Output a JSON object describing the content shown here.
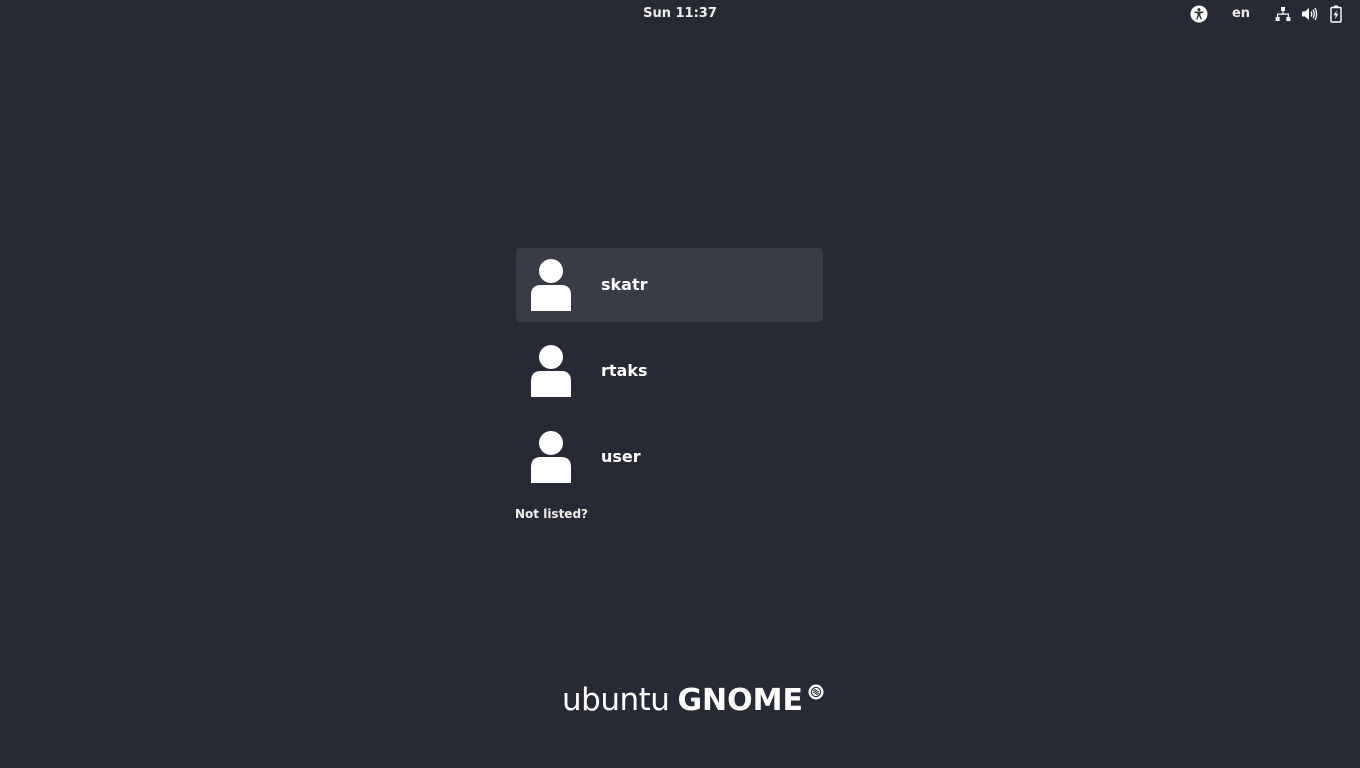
{
  "topbar": {
    "clock": "Sun 11:37",
    "keyboard_layout": "en",
    "icons": [
      "accessibility-icon",
      "network-icon",
      "volume-icon",
      "battery-icon"
    ]
  },
  "users": [
    {
      "name": "skatr",
      "selected": true,
      "icon": "avatar-icon"
    },
    {
      "name": "rtaks",
      "selected": false,
      "icon": "avatar-icon"
    },
    {
      "name": "user",
      "selected": false,
      "icon": "avatar-icon"
    }
  ],
  "not_listed_label": "Not listed?",
  "logo": {
    "ubuntu": "ubuntu",
    "gnome": "GNOME"
  },
  "colors": {
    "background": "#272a34",
    "selected_row": "#393c45",
    "text": "#ffffff"
  }
}
